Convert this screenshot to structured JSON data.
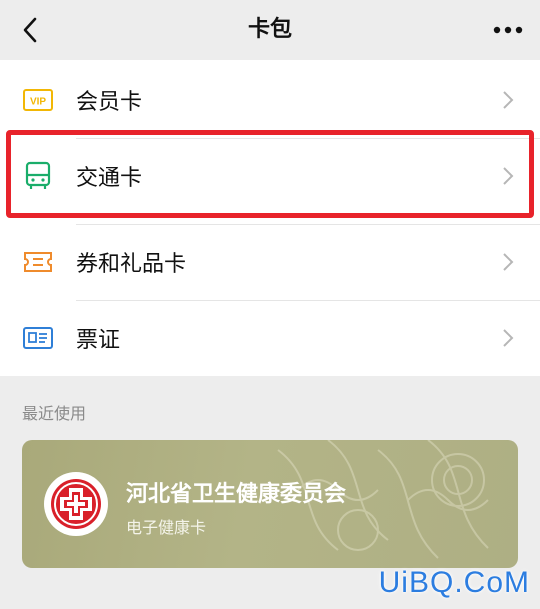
{
  "header": {
    "title": "卡包"
  },
  "items": [
    {
      "label": "会员卡",
      "icon": "vip-card-icon",
      "icon_text": "VIP",
      "color": "#f2b705"
    },
    {
      "label": "交通卡",
      "icon": "bus-icon",
      "color": "#1aad6a"
    },
    {
      "label": "券和礼品卡",
      "icon": "ticket-icon",
      "color": "#ef8b2c"
    },
    {
      "label": "票证",
      "icon": "id-card-icon",
      "color": "#2f7fd7"
    }
  ],
  "recent": {
    "title": "最近使用",
    "card": {
      "name": "河北省卫生健康委员会",
      "subtitle": "电子健康卡",
      "logo_color": "#d9202a"
    }
  },
  "watermark": "UiBQ.CoM",
  "colors": {
    "highlight": "#e8232b",
    "background": "#ededed"
  }
}
